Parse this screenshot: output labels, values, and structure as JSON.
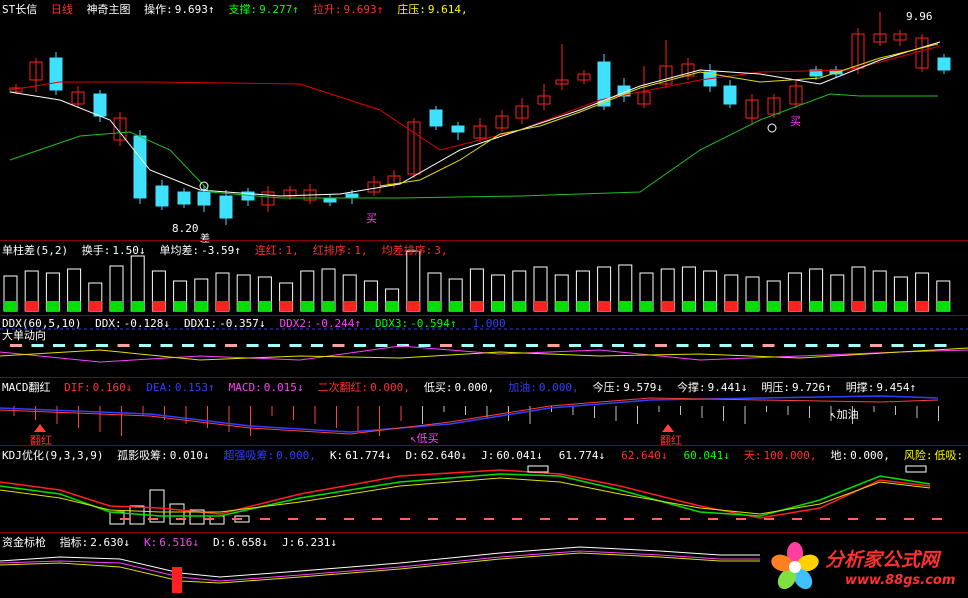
{
  "main": {
    "name": "ST长信",
    "period": "日线",
    "indicator": "神奇主图",
    "fields": [
      {
        "label": "操作:",
        "value": "9.693",
        "arrow": "↑",
        "color": "w"
      },
      {
        "label": "支撑:",
        "value": "9.277",
        "arrow": "↑",
        "color": "g"
      },
      {
        "label": "拉升:",
        "value": "9.693",
        "arrow": "↑",
        "color": "r"
      },
      {
        "label": "庄压:",
        "value": "9.614",
        "arrow": ",",
        "color": "y"
      }
    ],
    "high_label": "9.96",
    "low_label": "8.20",
    "buy_label": "买",
    "buy_label2": "买",
    "diff_label": "差"
  },
  "p2": {
    "title": "单柱差(5,2)",
    "items": [
      {
        "label": "换手:",
        "value": "1.50",
        "arrow": "↓",
        "color": "w"
      },
      {
        "label": "单均差:",
        "value": "-3.59",
        "arrow": "↑",
        "color": "w"
      },
      {
        "label": "连红:",
        "value": "1",
        "arrow": ",",
        "color": "r"
      },
      {
        "label": "红排序:",
        "value": "1",
        "arrow": ",",
        "color": "r"
      },
      {
        "label": "均差排序:",
        "value": "3",
        "arrow": ",",
        "color": "r"
      }
    ]
  },
  "p3": {
    "title": "DDX(60,5,10)",
    "subtitle": "大单动向",
    "items": [
      {
        "label": "DDX:",
        "value": "-0.128",
        "arrow": "↓",
        "color": "w"
      },
      {
        "label": "DDX1:",
        "value": "-0.357",
        "arrow": "↓",
        "color": "w"
      },
      {
        "label": "DDX2:",
        "value": "-0.244",
        "arrow": "↑",
        "color": "m"
      },
      {
        "label": "DDX3:",
        "value": "-0.594",
        "arrow": "↑",
        "color": "g"
      },
      {
        "label": "",
        "value": "1.000",
        "arrow": "",
        "color": "b"
      }
    ]
  },
  "p4": {
    "title": "MACD翻红",
    "items": [
      {
        "label": "DIF:",
        "value": "0.160",
        "arrow": "↓",
        "color": "r"
      },
      {
        "label": "DEA:",
        "value": "0.153",
        "arrow": "↑",
        "color": "b"
      },
      {
        "label": "MACD:",
        "value": "0.015",
        "arrow": "↓",
        "color": "m"
      },
      {
        "label": "二次翻红:",
        "value": "0.000",
        "arrow": ",",
        "color": "r"
      },
      {
        "label": "低买:",
        "value": "0.000",
        "arrow": ",",
        "color": "w"
      },
      {
        "label": "加油:",
        "value": "0.000",
        "arrow": ",",
        "color": "b"
      },
      {
        "label": "今压:",
        "value": "9.579",
        "arrow": "↓",
        "color": "w"
      },
      {
        "label": "今撑:",
        "value": "9.441",
        "arrow": "↓",
        "color": "w"
      },
      {
        "label": "明压:",
        "value": "9.726",
        "arrow": "↑",
        "color": "w"
      },
      {
        "label": "明撑:",
        "value": "9.454",
        "arrow": "↑",
        "color": "w"
      }
    ],
    "fanhong": "翻红",
    "fanhong2": "翻红",
    "dimai": "↖低买",
    "jiayou": "↖加油"
  },
  "p5": {
    "title": "KDJ优化(9,3,3,9)",
    "items": [
      {
        "label": "孤影吸筹:",
        "value": "0.010",
        "arrow": "↓",
        "color": "w"
      },
      {
        "label": "超强吸筹:",
        "value": "0.000",
        "arrow": ",",
        "color": "b"
      },
      {
        "label": "K:",
        "value": "61.774",
        "arrow": "↓",
        "color": "w"
      },
      {
        "label": "D:",
        "value": "62.640",
        "arrow": "↓",
        "color": "w"
      },
      {
        "label": "J:",
        "value": "60.041",
        "arrow": "↓",
        "color": "w"
      },
      {
        "label": "",
        "value": "61.774",
        "arrow": "↓",
        "color": "w"
      },
      {
        "label": "",
        "value": "62.640",
        "arrow": "↓",
        "color": "r"
      },
      {
        "label": "",
        "value": "60.041",
        "arrow": "↓",
        "color": "g"
      },
      {
        "label": "天:",
        "value": "100.000",
        "arrow": ",",
        "color": "r"
      },
      {
        "label": "地:",
        "value": "0.000",
        "arrow": ",",
        "color": "w"
      },
      {
        "label": "风险:",
        "value": "低吸:",
        "arrow": "",
        "color": "y"
      }
    ]
  },
  "p6": {
    "title": "资金标枪",
    "items": [
      {
        "label": "指标:",
        "value": "2.630",
        "arrow": "↓",
        "color": "w"
      },
      {
        "label": "K:",
        "value": "6.516",
        "arrow": "↓",
        "color": "m"
      },
      {
        "label": "D:",
        "value": "6.658",
        "arrow": "↓",
        "color": "w"
      },
      {
        "label": "J:",
        "value": "6.231",
        "arrow": "↓",
        "color": "w"
      }
    ]
  },
  "watermark": {
    "name": "分析家公式网",
    "url": "www.88gs.com"
  },
  "colors": {
    "up": "#ff2020",
    "down": "#40e0ff",
    "ma_white": "#ffffff",
    "ma_red": "#e00000",
    "ma_green": "#20c020",
    "ma_yellow": "#e0e000"
  }
}
